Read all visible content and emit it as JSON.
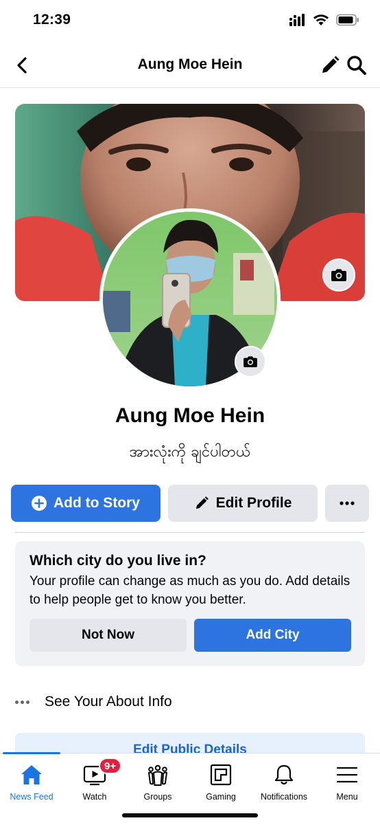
{
  "status": {
    "time": "12:39"
  },
  "nav": {
    "title": "Aung Moe Hein"
  },
  "profile": {
    "name": "Aung Moe Hein",
    "bio": "အားလုံးကို ချင်ပါတယ်"
  },
  "actions": {
    "add_story": "Add to Story",
    "edit_profile": "Edit Profile"
  },
  "city_prompt": {
    "title": "Which city do you live in?",
    "description": "Your profile can change as much as you do. Add details to help people get to know you better.",
    "not_now": "Not Now",
    "add_city": "Add City"
  },
  "about": {
    "label": "See Your About Info"
  },
  "edit_public": {
    "label": "Edit Public Details"
  },
  "tabs": [
    {
      "label": "News Feed",
      "icon": "home-icon",
      "active": true
    },
    {
      "label": "Watch",
      "icon": "watch-icon",
      "badge": "9+"
    },
    {
      "label": "Groups",
      "icon": "groups-icon"
    },
    {
      "label": "Gaming",
      "icon": "gaming-icon"
    },
    {
      "label": "Notifications",
      "icon": "bell-icon"
    },
    {
      "label": "Menu",
      "icon": "menu-icon"
    }
  ],
  "colors": {
    "primary": "#2d74e1",
    "badge": "#e41e3f",
    "secondary_button": "#e4e6eb",
    "card_background": "#f0f2f5"
  }
}
